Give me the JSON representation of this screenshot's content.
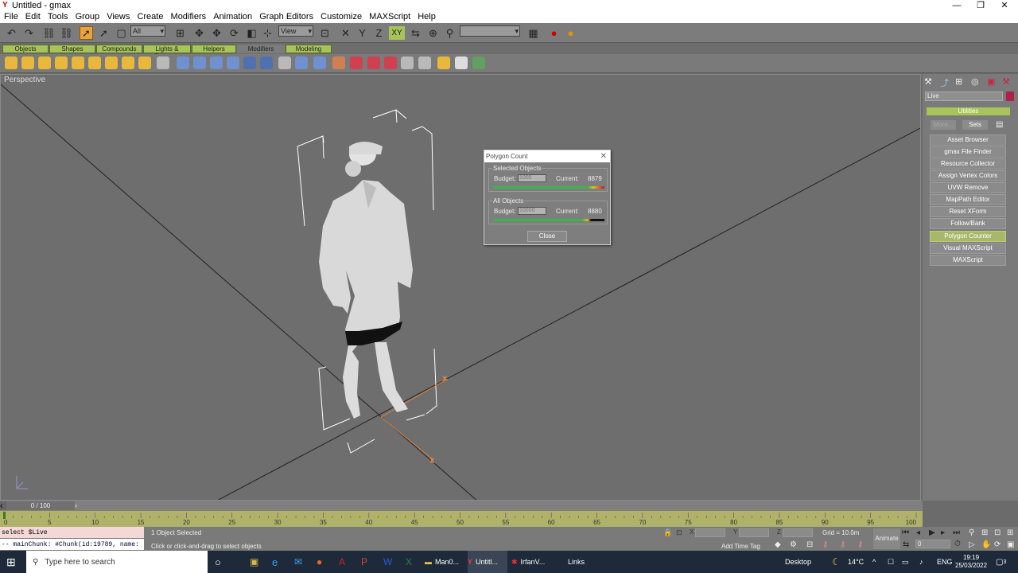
{
  "window": {
    "title": "Untitled - gmax",
    "minimize": "—",
    "restore": "❐",
    "close": "✕"
  },
  "menu": [
    "File",
    "Edit",
    "Tools",
    "Group",
    "Views",
    "Create",
    "Modifiers",
    "Animation",
    "Graph Editors",
    "Customize",
    "MAXScript",
    "Help"
  ],
  "toolbar": {
    "filter_value": "All",
    "refcoord_value": "View",
    "named_sel_value": "",
    "axis_label": "XY"
  },
  "tabs": [
    "Objects",
    "Shapes",
    "Compounds",
    "Lights & Cameras",
    "Helpers",
    "Modifiers",
    "Modeling"
  ],
  "viewport": {
    "label": "Perspective"
  },
  "dialog": {
    "title": "Polygon Count",
    "selected": {
      "group": "Selected Objects",
      "budget_label": "Budget:",
      "budget_value": "1000",
      "current_label": "Current:",
      "current_value": "8879"
    },
    "all": {
      "group": "All Objects",
      "budget_label": "Budget:",
      "budget_value": "10000",
      "current_label": "Current:",
      "current_value": "8880"
    },
    "close_label": "Close"
  },
  "rightpanel": {
    "name_value": "Live",
    "rollout": "Utilities",
    "more": "More...",
    "sets": "Sets",
    "items": [
      "Asset Browser",
      "gmax File Finder",
      "Resource Collector",
      "Assign Vertex Colors",
      "UVW Remove",
      "MapPath Editor",
      "Reset XForm",
      "Follow/Bank",
      "Polygon Counter",
      "Visual MAXScript",
      "MAXScript"
    ],
    "active_item": "Polygon Counter"
  },
  "trackbar": {
    "frame": "0 / 100"
  },
  "timeline": {
    "ticks": [
      "0",
      "5",
      "10",
      "15",
      "20",
      "25",
      "30",
      "35",
      "40",
      "45",
      "50",
      "55",
      "60",
      "65",
      "70",
      "75",
      "80",
      "85",
      "90",
      "95",
      "100"
    ]
  },
  "status": {
    "script_line1": "select $Live",
    "script_line2": "--   mainChunk: #Chunk(id:19789, name:",
    "selection": "1 Object Selected",
    "prompt": "Click or click-and-drag to select objects",
    "x_label": "X",
    "y_label": "Y",
    "z_label": "Z",
    "grid": "Grid = 10.0m",
    "add_time_tag": "Add Time Tag",
    "animate": "Animate",
    "frame_value": "0"
  },
  "taskbar": {
    "search": "Type here to search",
    "apps": [
      "Man0...",
      "Untitl...",
      "IrfanV..."
    ],
    "links": "Links",
    "desktop": "Desktop",
    "weather": "14°C",
    "lang": "ENG",
    "time": "19:19",
    "date": "25/03/2022",
    "notif": "3"
  }
}
